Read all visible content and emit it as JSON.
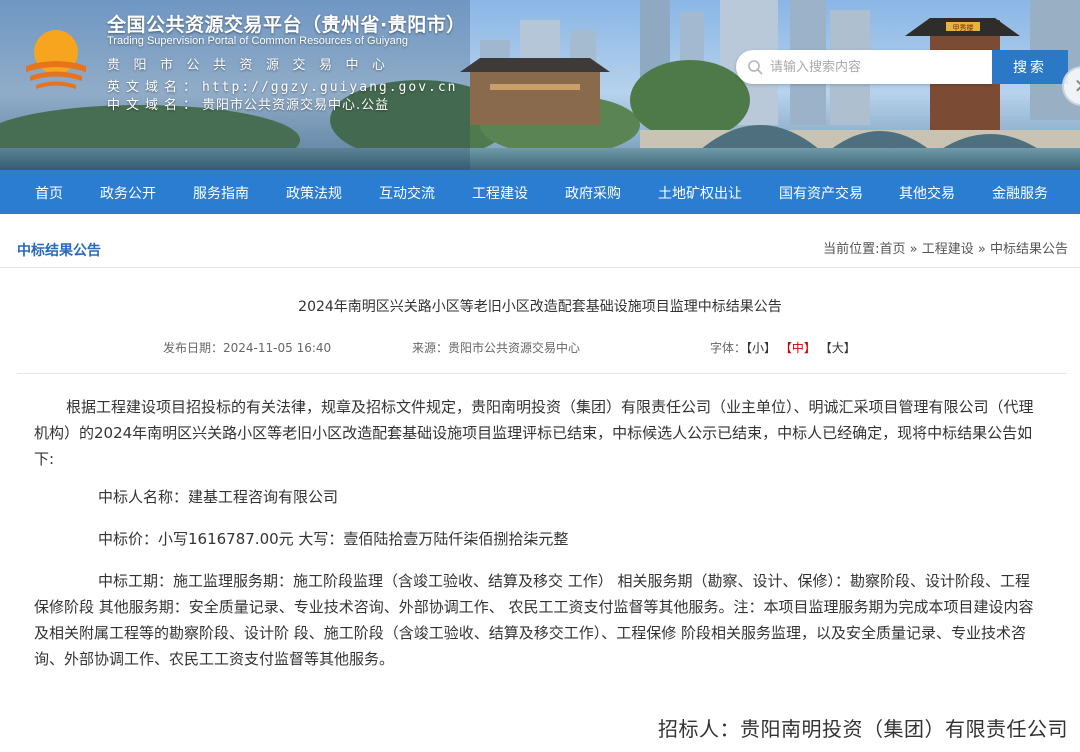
{
  "header": {
    "site_title": "全国公共资源交易平台（贵州省·贵阳市）",
    "site_subtitle": "Trading Supervision Portal of Common Resources of Guiyang",
    "site_center": "贵阳市公共资源交易中心",
    "en_domain_label": "英文域名：",
    "en_domain_value": "http://ggzy.guiyang.gov.cn",
    "cn_domain_label": "中文域名：",
    "cn_domain_value": "贵阳市公共资源交易中心.公益",
    "search_placeholder": "请输入搜索内容",
    "search_button": "搜索",
    "banner_sign": "甲秀楼"
  },
  "nav": {
    "items": [
      "首页",
      "政务公开",
      "服务指南",
      "政策法规",
      "互动交流",
      "工程建设",
      "政府采购",
      "土地矿权出让",
      "国有资产交易",
      "其他交易",
      "金融服务"
    ]
  },
  "breadcrumb": {
    "section_title": "中标结果公告",
    "prefix": "当前位置:",
    "items": [
      "首页",
      "工程建设",
      "中标结果公告"
    ],
    "separator": "»"
  },
  "article": {
    "title": "2024年南明区兴关路小区等老旧小区改造配套基础设施项目监理中标结果公告",
    "publish_date_label": "发布日期：",
    "publish_date": "2024-11-05 16:40",
    "source_label": "来源：",
    "source": "贵阳市公共资源交易中心",
    "font_label": "字体：",
    "font_small": "【小】",
    "font_medium": "【中】",
    "font_large": "【大】",
    "intro": "根据工程建设项目招投标的有关法律，规章及招标文件规定，贵阳南明投资（集团）有限责任公司（业主单位）、明诚汇采项目管理有限公司（代理机构）的2024年南明区兴关路小区等老旧小区改造配套基础设施项目监理评标已结束，中标候选人公示已结束，中标人已经确定，现将中标结果公告如下:",
    "winner": "中标人名称：建基工程咨询有限公司",
    "price": "中标价：小写1616787.00元 大写：壹佰陆拾壹万陆仟柒佰捌拾柒元整",
    "period": "中标工期：施工监理服务期：施工阶段监理（含竣工验收、结算及移交 工作） 相关服务期（勘察、设计、保修）：勘察阶段、设计阶段、工程保修阶段 其他服务期：安全质量记录、专业技术咨询、外部协调工作、 农民工工资支付监督等其他服务。注：本项目监理服务期为完成本项目建设内容及相关附属工程等的勘察阶段、设计阶 段、施工阶段（含竣工验收、结算及移交工作）、工程保修 阶段相关服务监理，以及安全质量记录、专业技术咨询、外部协调工作、农民工工资支付监督等其他服务。",
    "signature": "招标人：贵阳南明投资（集团）有限责任公司"
  }
}
